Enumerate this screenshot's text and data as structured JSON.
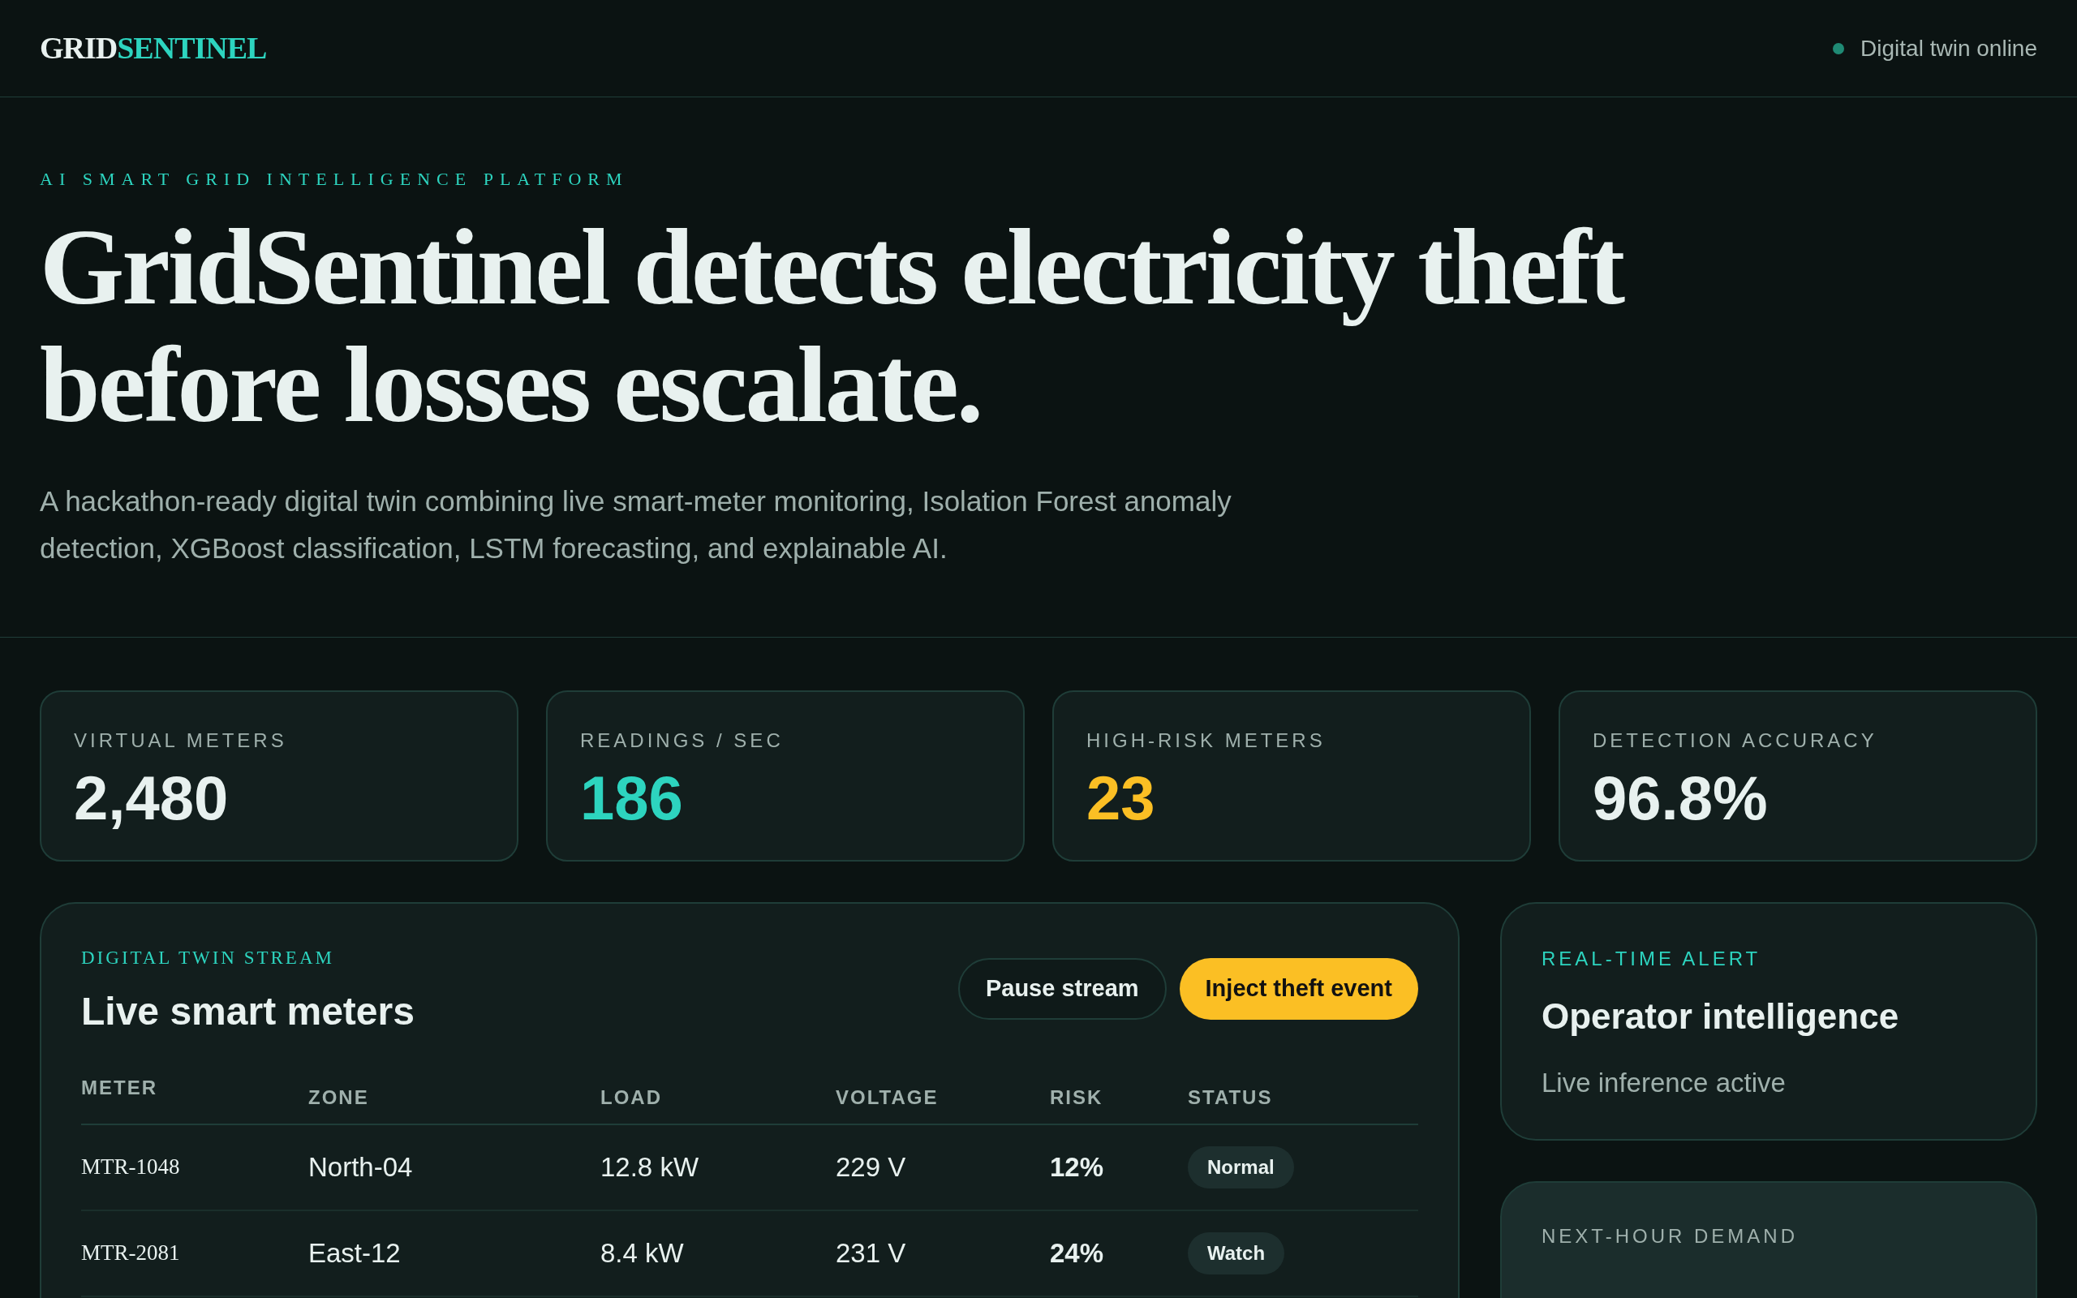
{
  "header": {
    "logo": {
      "part_1": "GRID",
      "part_2": "SENTINEL"
    },
    "status": {
      "label": "Digital twin online",
      "online": true
    }
  },
  "hero": {
    "eyebrow": "AI SMART GRID INTELLIGENCE PLATFORM",
    "headline": "GridSentinel detects electricity theft before losses escalate.",
    "description": "A hackathon-ready digital twin combining live smart-meter monitoring, Isolation Forest anomaly detection, XGBoost classification, LSTM forecasting, and explainable AI."
  },
  "stats": [
    {
      "label": "VIRTUAL METERS",
      "value": "2,480",
      "color": "#e8f1ef"
    },
    {
      "label": "READINGS / SEC",
      "value": "186",
      "color": "#2dd4bf"
    },
    {
      "label": "HIGH-RISK METERS",
      "value": "23",
      "color": "#fbbf24"
    },
    {
      "label": "DETECTION ACCURACY",
      "value": "96.8%",
      "color": "#e8f1ef"
    }
  ],
  "stream": {
    "eyebrow": "DIGITAL TWIN STREAM",
    "title": "Live smart meters",
    "buttons": [
      {
        "label": "Pause stream",
        "kind": "secondary"
      },
      {
        "label": "Inject theft event",
        "kind": "primary"
      }
    ],
    "table": {
      "columns": [
        "METER",
        "ZONE",
        "LOAD",
        "VOLTAGE",
        "RISK",
        "STATUS"
      ],
      "rows": [
        {
          "meter": "MTR-1048",
          "zone": "North-04",
          "load": "12.8 kW",
          "voltage": "229 V",
          "risk": "12%",
          "status": "Normal"
        },
        {
          "meter": "MTR-2081",
          "zone": "East-12",
          "load": "8.4 kW",
          "voltage": "231 V",
          "risk": "24%",
          "status": "Watch"
        }
      ]
    }
  },
  "alert": {
    "eyebrow": "REAL-TIME ALERT",
    "title": "Operator intelligence",
    "subtitle": "Live inference active"
  },
  "demand": {
    "label": "NEXT-HOUR DEMAND"
  }
}
